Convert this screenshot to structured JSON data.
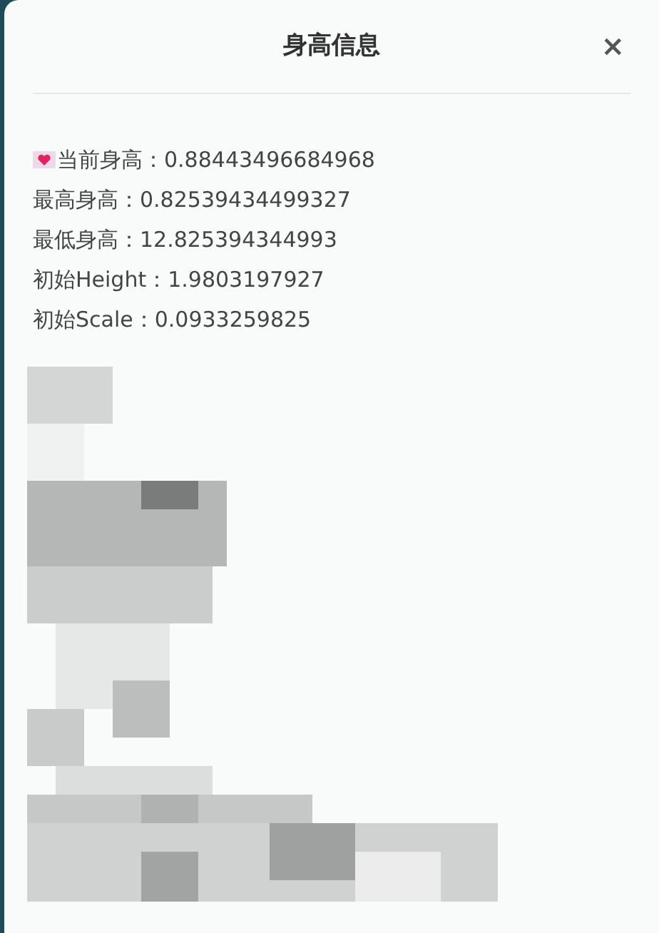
{
  "dialog": {
    "title": "身高信息",
    "close": "×"
  },
  "lines": [
    {
      "kind": "heart",
      "text": "当前身高：0.88443496684968"
    },
    {
      "kind": "plain",
      "text": "最高身高：0.82539434499327"
    },
    {
      "kind": "plain",
      "text": "最低身高：12.825394344993"
    },
    {
      "kind": "plain",
      "text": "初始Height：1.9803197927"
    },
    {
      "kind": "plain",
      "text": "初始Scale：0.0933259825"
    }
  ]
}
